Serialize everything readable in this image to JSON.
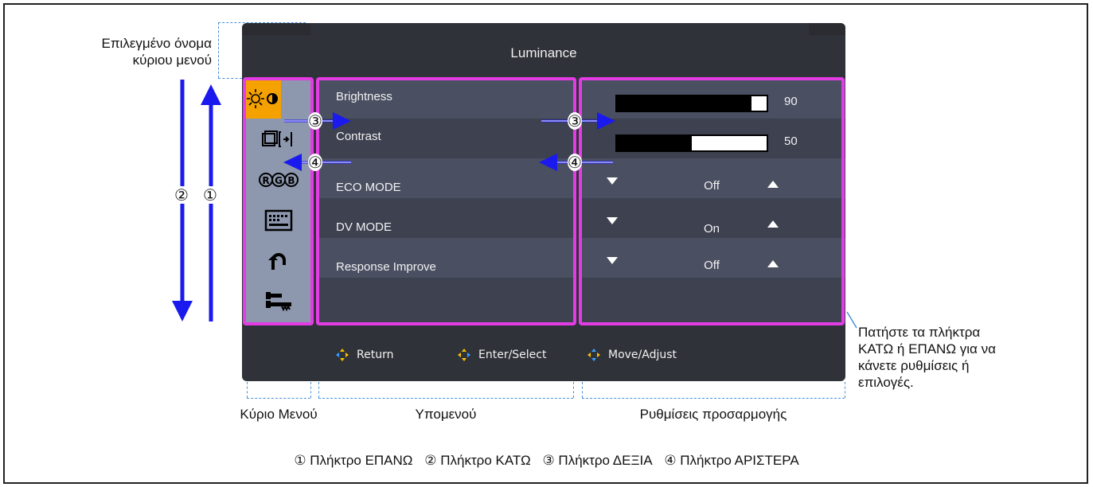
{
  "osd": {
    "title": "Luminance",
    "main_menu_icons": [
      "brightness-contrast-icon",
      "picture-size-icon",
      "rgb-icon",
      "osd-settings-icon",
      "return-icon",
      "tools-icon"
    ],
    "submenu": [
      {
        "label": "Brightness"
      },
      {
        "label": "Contrast"
      },
      {
        "label": "ECO MODE"
      },
      {
        "label": "DV MODE"
      },
      {
        "label": "Response Improve"
      }
    ],
    "adjust": {
      "brightness": {
        "value": "90",
        "fill_fraction": 0.9
      },
      "contrast": {
        "value": "50",
        "fill_fraction": 0.5
      },
      "eco_mode": "Off",
      "dv_mode": "On",
      "response_improve": "Off"
    },
    "footer": {
      "return": "Return",
      "enter_select": "Enter/Select",
      "move_adjust": "Move/Adjust"
    }
  },
  "callouts": {
    "selected_menu_name_line1": "Επιλεγμένο όνομα",
    "selected_menu_name_line2": "κύριου μενού",
    "press_keys_line1": "Πατήστε τα πλήκτρα",
    "press_keys_line2": "ΚΑΤΩ ή ΕΠΑΝΩ για να",
    "press_keys_line3": "κάνετε ρυθμίσεις ή",
    "press_keys_line4": "επιλογές.",
    "main_menu": "Κύριο Μενού",
    "submenu": "Υπομενού",
    "adjust_settings": "Ρυθμίσεις προσαρμογής"
  },
  "markers": {
    "up": "①",
    "down": "②",
    "right": "③",
    "left": "④"
  },
  "legend": {
    "up": "① Πλήκτρο ΕΠΑΝΩ",
    "down": "② Πλήκτρο ΚΑΤΩ",
    "right": "③ Πλήκτρο ΔΕΞΙΑ",
    "left": "④ Πλήκτρο ΑΡΙΣΤΕΡΑ"
  },
  "colors": {
    "arrow": "#1a1aee",
    "highlight": "#e43ce4",
    "active_menu": "#f5a100",
    "dashed_guide": "#4a90d9"
  }
}
